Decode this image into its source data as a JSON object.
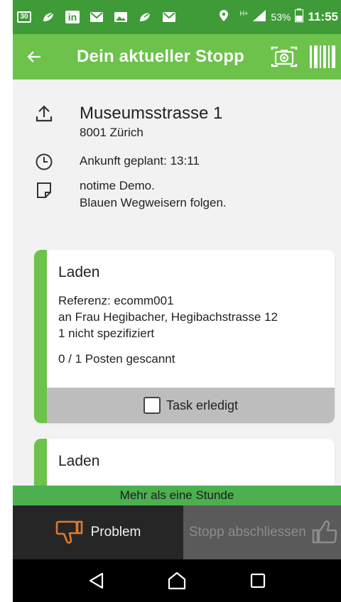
{
  "status_bar": {
    "calendar_day": "30",
    "linkedin": "in",
    "network_type": "H+",
    "battery": "53%",
    "time": "11:55"
  },
  "app_bar": {
    "title": "Dein aktueller Stopp",
    "back_icon": "arrow-left-icon",
    "camera_icon": "camera-icon",
    "barcode_icon": "barcode-icon"
  },
  "stop": {
    "street": "Museumsstrasse 1",
    "city": "8001 Zürich",
    "arrival": "Ankunft geplant:  13:11",
    "note_line1": "notime Demo.",
    "note_line2": "Blauen Wegweisern folgen."
  },
  "tasks": [
    {
      "title": "Laden",
      "reference": "Referenz: ecomm001",
      "recipient": "an Frau Hegibacher, Hegibachstrasse 12",
      "quantity": "1 nicht spezifiziert",
      "scanned": "0 / 1 Posten gescannt",
      "done_label": "Task erledigt",
      "done": false
    },
    {
      "title": "Laden"
    }
  ],
  "time_banner": "Mehr als eine Stunde",
  "actions": {
    "problem_label": "Problem",
    "close_label": "Stopp abschliessen"
  },
  "colors": {
    "status_bar": "#3f9b38",
    "app_bar": "#6cc24a",
    "accent": "#6cc24a",
    "problem_icon": "#e07a2f"
  }
}
